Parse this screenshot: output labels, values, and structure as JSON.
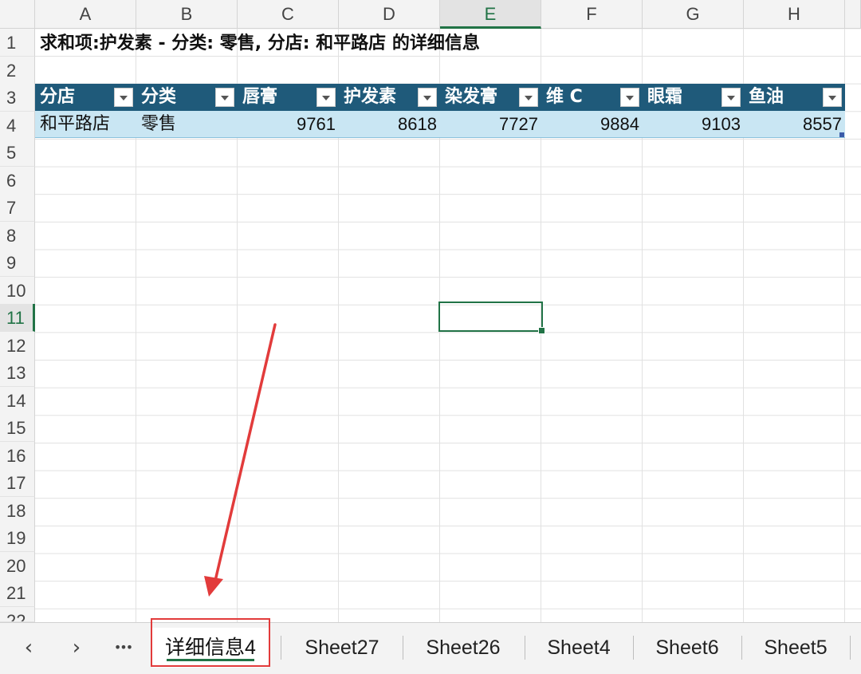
{
  "columns": [
    "A",
    "B",
    "C",
    "D",
    "E",
    "F",
    "G",
    "H"
  ],
  "selected_column": "E",
  "rows": [
    "1",
    "2",
    "3",
    "4",
    "5",
    "6",
    "7",
    "8",
    "9",
    "10",
    "11",
    "12",
    "13",
    "14",
    "15",
    "16",
    "17",
    "18",
    "19",
    "20",
    "21",
    "22"
  ],
  "selected_row": "11",
  "title": "求和项:护发素 - 分类: 零售, 分店: 和平路店 的详细信息",
  "table": {
    "headers": [
      "分店",
      "分类",
      "唇膏",
      "护发素",
      "染发膏",
      "维 C",
      "眼霜",
      "鱼油"
    ],
    "row": [
      "和平路店",
      "零售",
      "9761",
      "8618",
      "7727",
      "9884",
      "9103",
      "8557"
    ]
  },
  "tabs": {
    "prev": "‹",
    "next": "›",
    "more": "•••",
    "items": [
      "详细信息4",
      "Sheet27",
      "Sheet26",
      "Sheet4",
      "Sheet6",
      "Sheet5"
    ],
    "active": "详细信息4"
  },
  "colors": {
    "accent": "#217346",
    "table_header": "#1f5a7a",
    "table_row": "#c9e6f3",
    "annotation": "#e23b3b"
  }
}
